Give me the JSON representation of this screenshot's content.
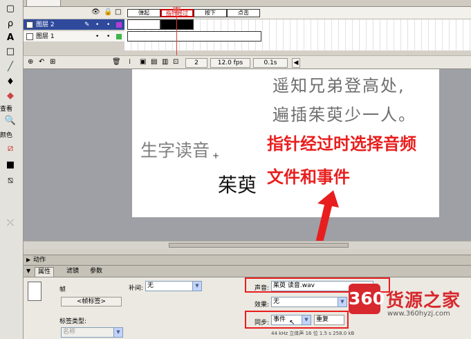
{
  "tools": {
    "section_view": "查看",
    "section_color": "颜色",
    "icons": [
      "subselect-icon",
      "lasso-icon",
      "text-tool-icon",
      "rectangle-tool-icon",
      "brush-tool-icon",
      "ink-bottle-icon",
      "eraser-icon"
    ]
  },
  "timeline": {
    "layers": [
      {
        "name": "图层 2",
        "selected": true,
        "color": "#b63cd4"
      },
      {
        "name": "图层 1",
        "selected": false,
        "color": "#3cb64a"
      }
    ],
    "frame_labels": [
      "弹起",
      "指针经过",
      "按下",
      "点击"
    ],
    "current_frame": "2",
    "frame_rate": "12.0 fps",
    "elapsed": "0.1s"
  },
  "stage": {
    "poem_line_1": "遥知兄弟登高处,",
    "poem_line_2": "遍插茱萸少一人。",
    "label_pronunciation": "生字读音",
    "word": "茱萸",
    "annotation_line_1": "指针经过时选择音频",
    "annotation_line_2": "文件和事件"
  },
  "panels": {
    "actions_title": "动作",
    "tabs": [
      "属性",
      "滤镜",
      "参数"
    ],
    "frame_label": "帧",
    "frame_label_button": "<帧标签>",
    "label_type_label": "标签类型:",
    "label_type_value": "名称",
    "tween_label": "补间:",
    "tween_value": "无",
    "sound_label": "声音:",
    "sound_value": "茱萸 读音.wav",
    "effect_label": "效果:",
    "effect_value": "无",
    "sync_label": "同步:",
    "sync_value": "事件",
    "repeat_value": "重复",
    "sound_info": "44 kHz 立体声 16 位 1.5 s 258.0 kB"
  },
  "watermark": {
    "badge": "360",
    "name": "货源之家",
    "url": "www.360hyzj.com"
  }
}
